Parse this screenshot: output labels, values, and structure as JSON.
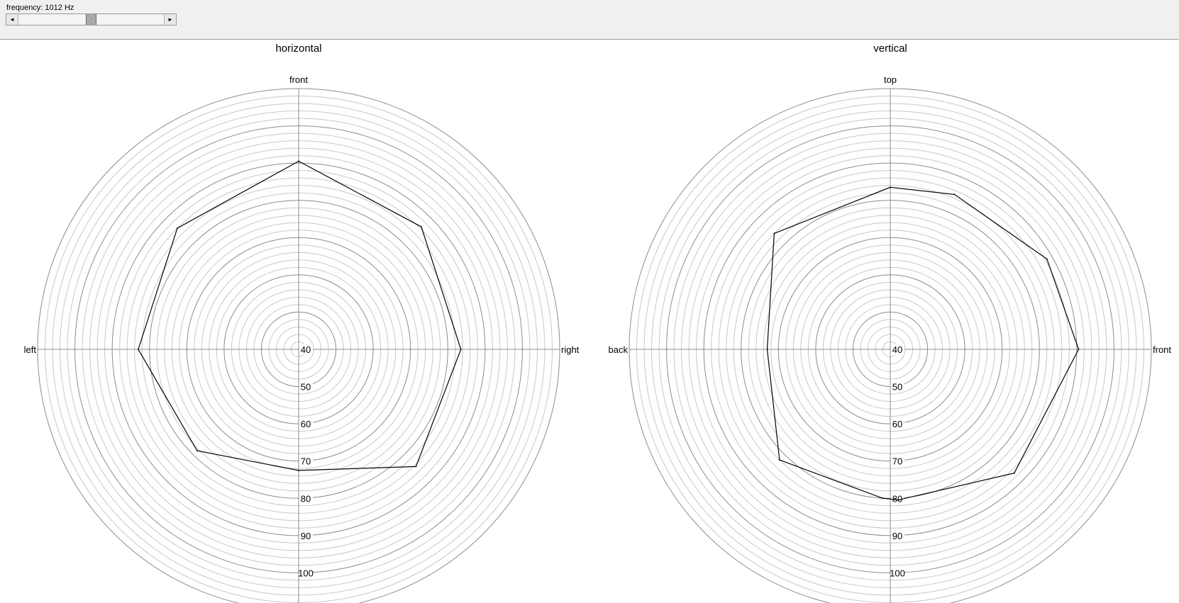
{
  "controls": {
    "frequency_label": "frequency: 1012 Hz",
    "frequency_slider_level": 0.5,
    "scroll_left_glyph": "◄",
    "scroll_right_glyph": "►"
  },
  "chart_data": [
    {
      "type": "polar-line",
      "title": "horizontal",
      "direction_labels": {
        "top": "front",
        "right": "right",
        "bottom": "",
        "left": "left"
      },
      "radial_min": 40,
      "radial_max": 110,
      "radial_tick_labels": [
        "40",
        "50",
        "60",
        "70",
        "80",
        "90",
        "100"
      ],
      "radial_tick_values": [
        40,
        50,
        60,
        70,
        80,
        90,
        100
      ],
      "angles_deg": [
        0,
        45,
        90,
        135,
        180,
        225,
        270,
        315
      ],
      "values": [
        90.5,
        86.5,
        83.5,
        84.5,
        72.5,
        78.5,
        83.0,
        86.0
      ],
      "grid": true,
      "line_color": "#000000",
      "grid_color": "#c8c8c8",
      "major_grid_color": "#8c8c8c"
    },
    {
      "type": "polar-line",
      "title": "vertical",
      "direction_labels": {
        "top": "top",
        "right": "front",
        "bottom": "",
        "left": "back"
      },
      "radial_min": 40,
      "radial_max": 110,
      "radial_tick_labels": [
        "40",
        "50",
        "60",
        "70",
        "80",
        "90",
        "100"
      ],
      "radial_tick_values": [
        40,
        50,
        60,
        70,
        80,
        90,
        100
      ],
      "angles_deg": [
        0,
        22.5,
        60,
        90,
        135,
        177,
        183,
        225,
        270,
        315
      ],
      "values": [
        83.5,
        85.0,
        88.5,
        90.5,
        87.0,
        80.5,
        80.0,
        82.0,
        73.0,
        84.0
      ],
      "grid": true,
      "line_color": "#000000",
      "grid_color": "#c8c8c8",
      "major_grid_color": "#8c8c8c"
    }
  ]
}
